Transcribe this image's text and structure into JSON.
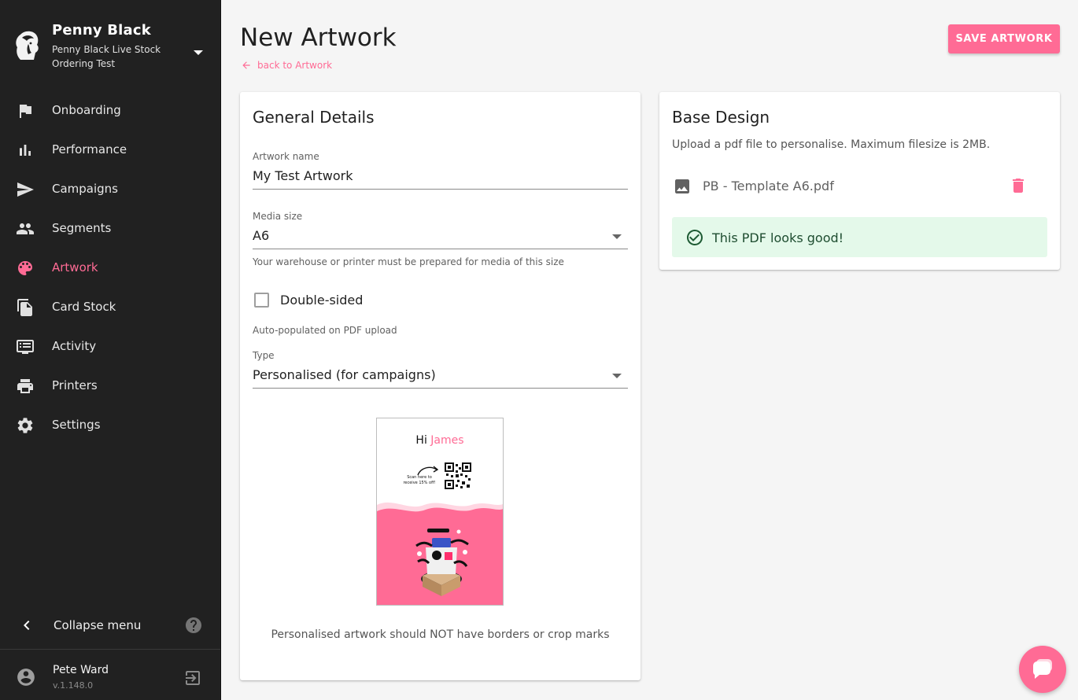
{
  "sidebar": {
    "brand_title": "Penny Black",
    "brand_subtitle": "Penny Black Live Stock Ordering Test",
    "items": [
      {
        "label": "Onboarding",
        "icon": "flag-icon"
      },
      {
        "label": "Performance",
        "icon": "bar-chart-icon"
      },
      {
        "label": "Campaigns",
        "icon": "send-icon"
      },
      {
        "label": "Segments",
        "icon": "people-icon"
      },
      {
        "label": "Artwork",
        "icon": "palette-icon",
        "active": true
      },
      {
        "label": "Card Stock",
        "icon": "file-copy-icon"
      },
      {
        "label": "Activity",
        "icon": "feed-icon"
      },
      {
        "label": "Printers",
        "icon": "printer-icon"
      },
      {
        "label": "Settings",
        "icon": "gear-icon"
      }
    ],
    "collapse_label": "Collapse menu",
    "user_name": "Pete Ward",
    "version": "v.1.148.0"
  },
  "header": {
    "title": "New Artwork",
    "back_label": "back to Artwork",
    "save_label": "SAVE ARTWORK"
  },
  "general": {
    "title": "General Details",
    "name_label": "Artwork name",
    "name_value": "My Test Artwork",
    "media_label": "Media size",
    "media_value": "A6",
    "media_helper": "Your warehouse or printer must be prepared for media of this size",
    "double_sided_label": "Double-sided",
    "double_sided_checked": false,
    "auto_note": "Auto-populated on PDF upload",
    "type_label": "Type",
    "type_value": "Personalised (for campaigns)",
    "preview": {
      "greeting": "Hi",
      "name": "James",
      "scan_text": "Scan here to receive 15% off!"
    },
    "preview_caption": "Personalised artwork should NOT have borders or crop marks"
  },
  "base": {
    "title": "Base Design",
    "description": "Upload a pdf file to personalise. Maximum filesize is 2MB.",
    "file_name": "PB - Template A6.pdf",
    "success_text": "This PDF looks good!"
  },
  "colors": {
    "accent": "#ff6b95",
    "sidebar_bg": "#212121",
    "success_bg": "#e4f9ea"
  }
}
